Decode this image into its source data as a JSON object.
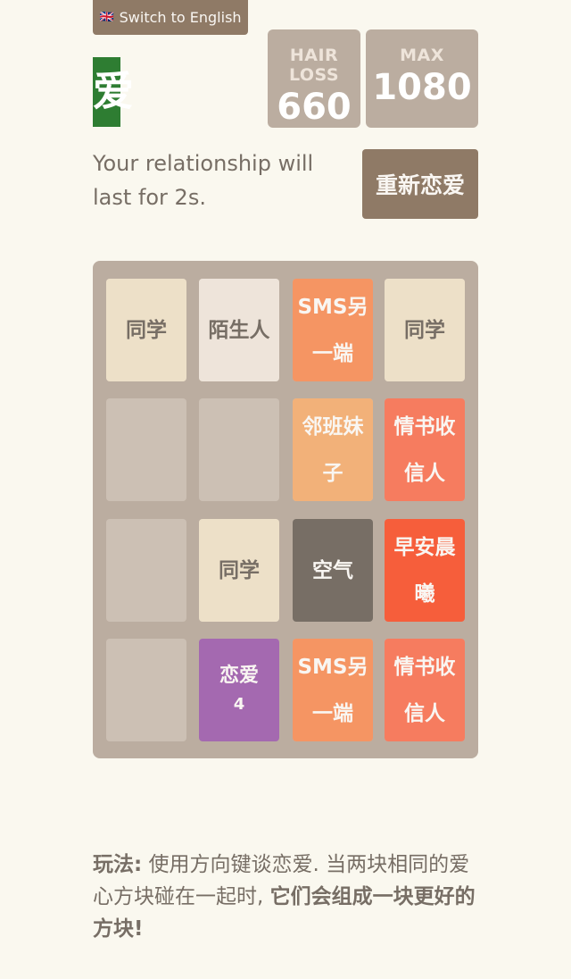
{
  "lang_button": {
    "flag": "🇬🇧",
    "label": "Switch to English"
  },
  "logo": {
    "text": "爱"
  },
  "scores": [
    {
      "label": "HAIR LOSS",
      "value": "660"
    },
    {
      "label": "MAX",
      "value": "1080"
    }
  ],
  "intro": "Your relationship will last for 2s.",
  "restart_label": "重新恋爱",
  "board": {
    "tiles": [
      {
        "row": 0,
        "col": 0,
        "text": "同学",
        "style": "b"
      },
      {
        "row": 0,
        "col": 1,
        "text": "陌生人",
        "style": "a"
      },
      {
        "row": 0,
        "col": 2,
        "text": "SMS另一端",
        "style": "d"
      },
      {
        "row": 0,
        "col": 3,
        "text": "同学",
        "style": "b"
      },
      {
        "row": 1,
        "col": 2,
        "text": "邻班妹子",
        "style": "c"
      },
      {
        "row": 1,
        "col": 3,
        "text": "情书收信人",
        "style": "e"
      },
      {
        "row": 2,
        "col": 1,
        "text": "同学",
        "style": "b"
      },
      {
        "row": 2,
        "col": 2,
        "text": "空气",
        "style": "air"
      },
      {
        "row": 2,
        "col": 3,
        "text": "早安晨曦",
        "style": "f"
      },
      {
        "row": 3,
        "col": 1,
        "text": "恋爱",
        "sub": "4",
        "style": "love"
      },
      {
        "row": 3,
        "col": 2,
        "text": "SMS另一端",
        "style": "d"
      },
      {
        "row": 3,
        "col": 3,
        "text": "情书收信人",
        "style": "e"
      }
    ]
  },
  "howto": {
    "label": "玩法:",
    "text": " 使用方向键谈恋爱. 当两块相同的爱心方块碰在一起时, ",
    "emphasis": "它们会组成一块更好的方块!"
  }
}
